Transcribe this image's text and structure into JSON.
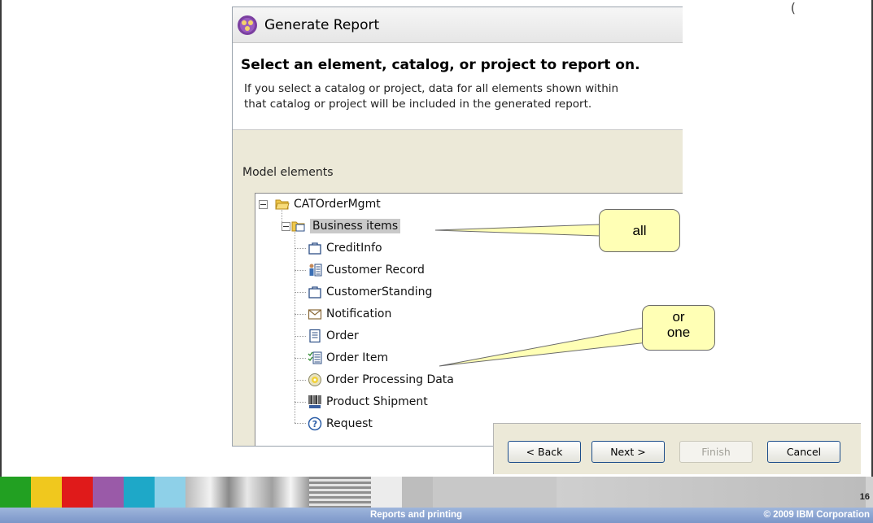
{
  "dialog": {
    "title": "Generate Report",
    "heading": "Select an element, catalog, or project to report on.",
    "description_line1": "If you select a catalog or project, data for all elements shown within",
    "description_line2": "that catalog or project will be included in the generated report.",
    "model_elements_label": "Model elements"
  },
  "tree": {
    "root": {
      "label": "CATOrderMgmt",
      "icon": "open-folder-icon"
    },
    "group": {
      "label": "Business items",
      "icon": "business-items-folder-icon",
      "selected": true
    },
    "items": [
      {
        "label": "CreditInfo",
        "icon": "business-item-icon"
      },
      {
        "label": "Customer Record",
        "icon": "person-record-icon"
      },
      {
        "label": "CustomerStanding",
        "icon": "business-item-icon"
      },
      {
        "label": "Notification",
        "icon": "envelope-icon"
      },
      {
        "label": "Order",
        "icon": "document-icon"
      },
      {
        "label": "Order Item",
        "icon": "checklist-icon"
      },
      {
        "label": "Order Processing Data",
        "icon": "disc-icon"
      },
      {
        "label": "Product Shipment",
        "icon": "barcode-icon"
      },
      {
        "label": "Request",
        "icon": "question-icon"
      }
    ]
  },
  "callouts": {
    "all": "all",
    "or_line1": "or",
    "or_line2": "one"
  },
  "buttons": {
    "back": "< Back",
    "next": "Next >",
    "finish": "Finish",
    "cancel": "Cancel"
  },
  "footer": {
    "title": "Reports and printing",
    "copyright": "© 2009 IBM Corporation",
    "page_number": "16"
  },
  "colors": {
    "callout": "#ffffb5",
    "footer_bar": "#7b96c8",
    "dialog_body": "#ece9d8"
  }
}
